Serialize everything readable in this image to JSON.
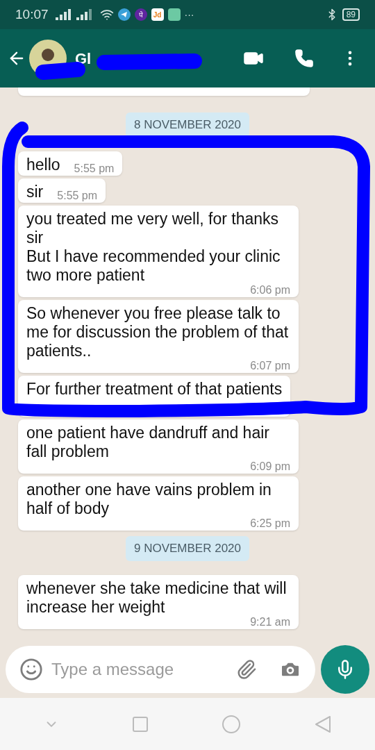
{
  "status_bar": {
    "time": "10:07",
    "app_badges": [
      "पे",
      "Jd"
    ],
    "more": "···",
    "battery": "89"
  },
  "header": {
    "title": "Gl"
  },
  "messages": [
    {
      "kind": "date",
      "text": "8 NOVEMBER 2020"
    },
    {
      "kind": "message",
      "text": "hello",
      "time": "5:55 pm"
    },
    {
      "kind": "message",
      "text": "sir",
      "time": "5:55 pm"
    },
    {
      "kind": "message",
      "text": "you treated me very well, for thanks sir\nBut I have recommended your clinic two more patient",
      "time": "6:06 pm"
    },
    {
      "kind": "message",
      "text": "So whenever you free please talk to me for discussion the problem of that patients..",
      "time": "6:07 pm"
    },
    {
      "kind": "message",
      "text": "For further treatment of that patients"
    },
    {
      "kind": "message",
      "text": "one patient have dandruff and hair fall problem",
      "time": "6:09 pm"
    },
    {
      "kind": "message",
      "text": "another one have vains problem in half of body",
      "time": "6:25 pm"
    },
    {
      "kind": "date",
      "text": "9 NOVEMBER 2020"
    },
    {
      "kind": "message",
      "text": "whenever she take medicine that will increase her weight",
      "time": "9:21 am"
    }
  ],
  "composer": {
    "placeholder": "Type a message"
  }
}
